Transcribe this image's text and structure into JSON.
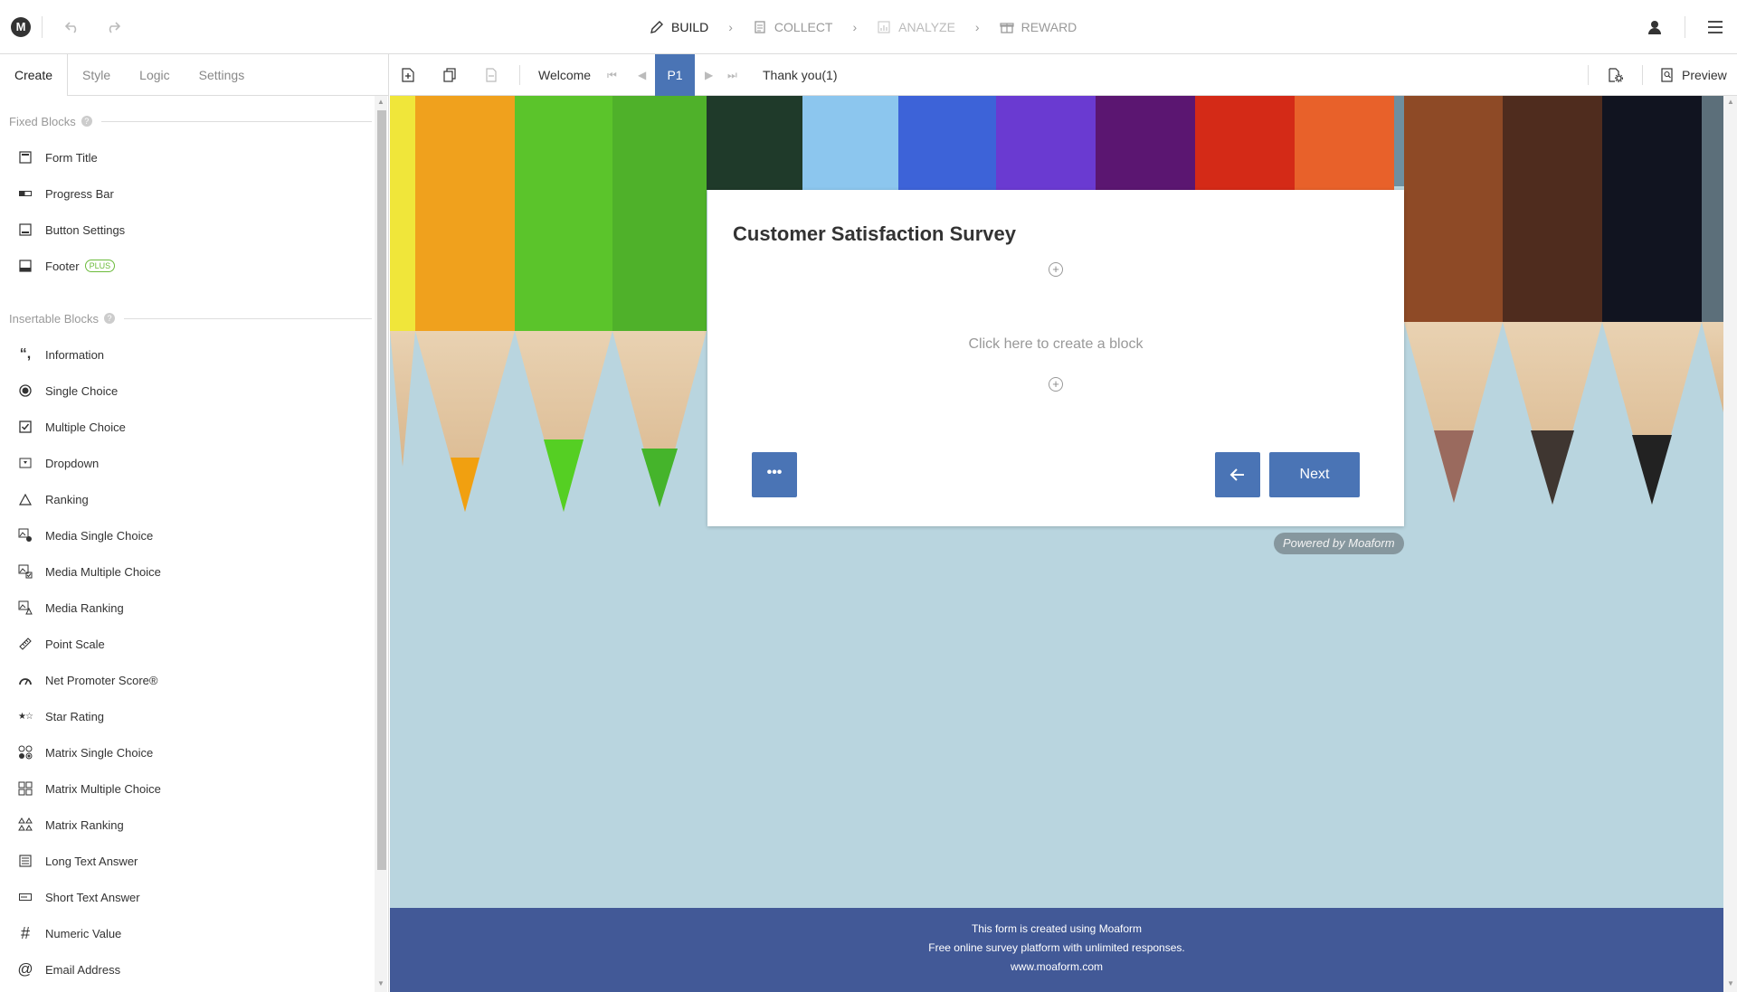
{
  "topbar": {
    "logo": "M",
    "steps": [
      {
        "label": "BUILD",
        "state": "active",
        "icon": "pencil-icon"
      },
      {
        "label": "COLLECT",
        "state": "normal",
        "icon": "document-icon"
      },
      {
        "label": "ANALYZE",
        "state": "disabled",
        "icon": "chart-icon"
      },
      {
        "label": "REWARD",
        "state": "normal",
        "icon": "gift-icon"
      }
    ]
  },
  "leftpanel": {
    "tabs": [
      "Create",
      "Style",
      "Logic",
      "Settings"
    ],
    "fixed_title": "Fixed Blocks",
    "fixed_items": [
      {
        "label": "Form Title",
        "icon": "form-title-icon"
      },
      {
        "label": "Progress Bar",
        "icon": "progress-bar-icon"
      },
      {
        "label": "Button Settings",
        "icon": "button-settings-icon"
      },
      {
        "label": "Footer",
        "icon": "footer-icon",
        "badge": "PLUS"
      }
    ],
    "insertable_title": "Insertable Blocks",
    "insertable_items": [
      {
        "label": "Information",
        "icon": "quote-icon"
      },
      {
        "label": "Single Choice",
        "icon": "radio-icon"
      },
      {
        "label": "Multiple Choice",
        "icon": "checkbox-icon"
      },
      {
        "label": "Dropdown",
        "icon": "dropdown-icon"
      },
      {
        "label": "Ranking",
        "icon": "triangle-icon"
      },
      {
        "label": "Media Single Choice",
        "icon": "media-radio-icon"
      },
      {
        "label": "Media Multiple Choice",
        "icon": "media-checkbox-icon"
      },
      {
        "label": "Media Ranking",
        "icon": "media-ranking-icon"
      },
      {
        "label": "Point Scale",
        "icon": "ruler-icon"
      },
      {
        "label": "Net Promoter Score®",
        "icon": "gauge-icon"
      },
      {
        "label": "Star Rating",
        "icon": "star-icon"
      },
      {
        "label": "Matrix Single Choice",
        "icon": "matrix-radio-icon"
      },
      {
        "label": "Matrix Multiple Choice",
        "icon": "matrix-checkbox-icon"
      },
      {
        "label": "Matrix Ranking",
        "icon": "matrix-ranking-icon"
      },
      {
        "label": "Long Text Answer",
        "icon": "long-text-icon"
      },
      {
        "label": "Short Text Answer",
        "icon": "short-text-icon"
      },
      {
        "label": "Numeric Value",
        "icon": "hash-icon"
      },
      {
        "label": "Email Address",
        "icon": "at-icon"
      }
    ]
  },
  "pagebar": {
    "welcome": "Welcome",
    "page": "P1",
    "thankyou": "Thank you(1)",
    "preview": "Preview"
  },
  "form": {
    "title": "Customer Satisfaction Survey",
    "hint": "Click here to create a block",
    "more": "•••",
    "next": "Next",
    "powered": "Powered by Moaform"
  },
  "footer": {
    "line1": "This form is created using Moaform",
    "line2": "Free online survey platform with unlimited responses.",
    "line3": "www.moaform.com"
  },
  "colors": {
    "accent": "#4a74b5",
    "footer_band": "#425997",
    "canvas_bg": "#b9d5df"
  }
}
